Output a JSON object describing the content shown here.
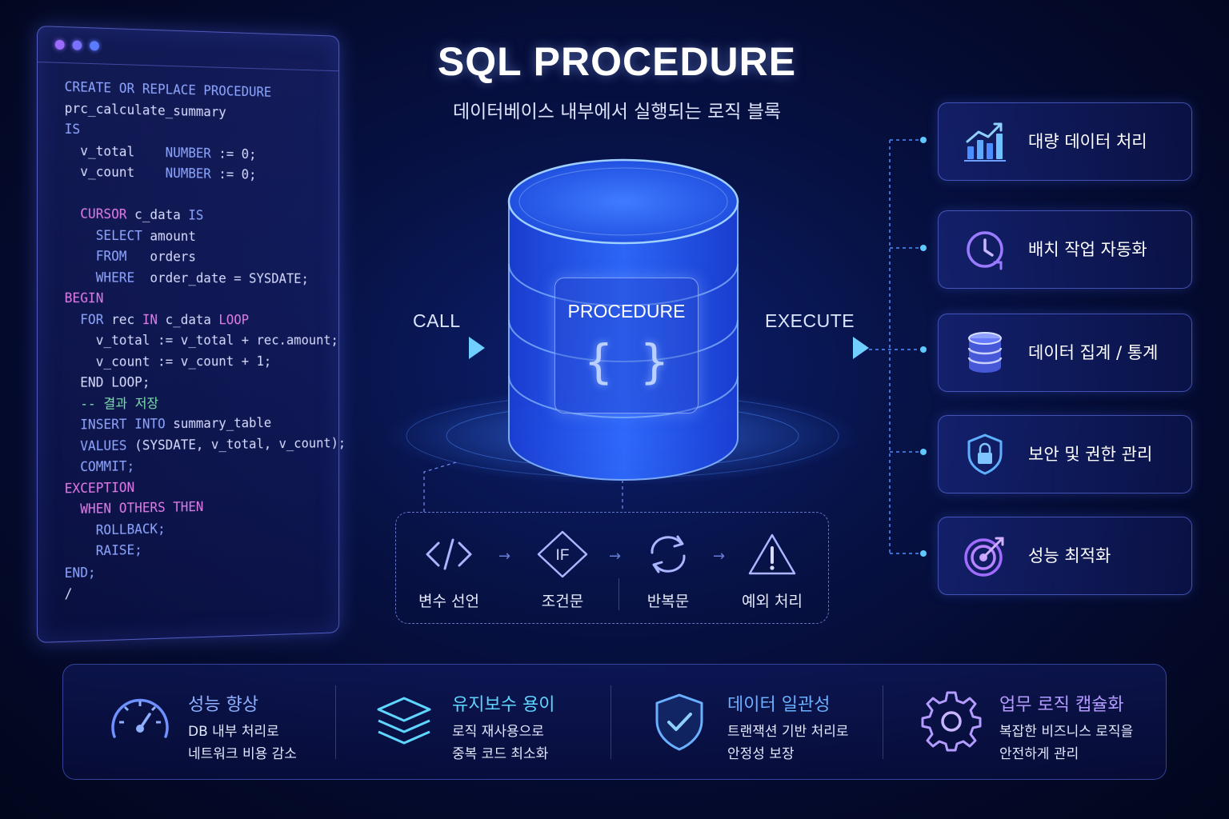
{
  "header": {
    "title": "SQL PROCEDURE",
    "subtitle": "데이터베이스 내부에서 실행되는 로직 블록"
  },
  "colors": {
    "accent": "#3d7bff",
    "title_dot_1": "#9b6bff",
    "title_dot_2": "#7a72ff",
    "title_dot_3": "#5b7bff",
    "keyword_blue": "#8ea6ff",
    "keyword_pink": "#e07ce8",
    "comment_green": "#7fe0b0"
  },
  "code": {
    "lines": [
      [
        {
          "t": "CREATE OR REPLACE PROCEDURE",
          "c": "kw"
        }
      ],
      [
        {
          "t": "prc_calculate_summary",
          "c": "id"
        }
      ],
      [
        {
          "t": "IS",
          "c": "kw"
        }
      ],
      [
        {
          "t": "  v_total    ",
          "c": "id"
        },
        {
          "t": "NUMBER",
          "c": "kw"
        },
        {
          "t": " := 0;",
          "c": "id"
        }
      ],
      [
        {
          "t": "  v_count    ",
          "c": "id"
        },
        {
          "t": "NUMBER",
          "c": "kw"
        },
        {
          "t": " := 0;",
          "c": "id"
        }
      ],
      [
        {
          "t": "",
          "c": "id"
        }
      ],
      [
        {
          "t": "  CURSOR",
          "c": "kw2"
        },
        {
          "t": " c_data ",
          "c": "id"
        },
        {
          "t": "IS",
          "c": "kw"
        }
      ],
      [
        {
          "t": "    SELECT",
          "c": "kw"
        },
        {
          "t": " amount",
          "c": "id"
        }
      ],
      [
        {
          "t": "    FROM",
          "c": "kw"
        },
        {
          "t": "   orders",
          "c": "id"
        }
      ],
      [
        {
          "t": "    WHERE",
          "c": "kw"
        },
        {
          "t": "  order_date = SYSDATE;",
          "c": "id"
        }
      ],
      [
        {
          "t": "BEGIN",
          "c": "kw2"
        }
      ],
      [
        {
          "t": "  FOR",
          "c": "kw"
        },
        {
          "t": " rec ",
          "c": "id"
        },
        {
          "t": "IN",
          "c": "kw2"
        },
        {
          "t": " c_data ",
          "c": "id"
        },
        {
          "t": "LOOP",
          "c": "kw2"
        }
      ],
      [
        {
          "t": "    v_total := v_total + rec.amount;",
          "c": "id"
        }
      ],
      [
        {
          "t": "    v_count := v_count + 1;",
          "c": "id"
        }
      ],
      [
        {
          "t": "  END LOOP;",
          "c": "id"
        }
      ],
      [
        {
          "t": "  -- 결과 저장",
          "c": "cm"
        }
      ],
      [
        {
          "t": "  INSERT INTO",
          "c": "kw"
        },
        {
          "t": " summary_table",
          "c": "id"
        }
      ],
      [
        {
          "t": "  VALUES",
          "c": "kw"
        },
        {
          "t": " (SYSDATE, v_total, v_count);",
          "c": "id"
        }
      ],
      [
        {
          "t": "  COMMIT;",
          "c": "kw"
        }
      ],
      [
        {
          "t": "EXCEPTION",
          "c": "kw2"
        }
      ],
      [
        {
          "t": "  WHEN OTHERS THEN",
          "c": "kw2"
        }
      ],
      [
        {
          "t": "    ROLLBACK;",
          "c": "kw"
        }
      ],
      [
        {
          "t": "    RAISE;",
          "c": "kw"
        }
      ],
      [
        {
          "t": "END;",
          "c": "kw"
        }
      ],
      [
        {
          "t": "/",
          "c": "id"
        }
      ]
    ]
  },
  "flow": {
    "call_label": "CALL",
    "execute_label": "EXECUTE",
    "procedure_label": "PROCEDURE",
    "procedure_icon": "{ }"
  },
  "steps": [
    {
      "label": "변수 선언",
      "icon": "code-icon"
    },
    {
      "label": "조건문",
      "icon": "if-diamond-icon",
      "icon_text": "IF"
    },
    {
      "label": "반복문",
      "icon": "loop-icon"
    },
    {
      "label": "예외 처리",
      "icon": "warning-icon"
    }
  ],
  "features": [
    {
      "label": "대량 데이터 처리",
      "icon": "bar-chart-icon"
    },
    {
      "label": "배치 작업 자동화",
      "icon": "clock-icon"
    },
    {
      "label": "데이터 집계 / 통계",
      "icon": "database-icon"
    },
    {
      "label": "보안 및 권한 관리",
      "icon": "lock-shield-icon"
    },
    {
      "label": "성능 최적화",
      "icon": "target-icon"
    }
  ],
  "benefits": [
    {
      "title": "성능 향상",
      "desc": [
        "DB 내부 처리로",
        "네트워크 비용 감소"
      ],
      "icon": "speedometer-icon",
      "color": "#8fb0ff"
    },
    {
      "title": "유지보수 용이",
      "desc": [
        "로직 재사용으로",
        "중복 코드 최소화"
      ],
      "icon": "layers-icon",
      "color": "#5fd6ff"
    },
    {
      "title": "데이터 일관성",
      "desc": [
        "트랜잭션 기반 처리로",
        "안정성 보장"
      ],
      "icon": "shield-check-icon",
      "color": "#6ab0ff"
    },
    {
      "title": "업무 로직 캡슐화",
      "desc": [
        "복잡한 비즈니스 로직을",
        "안전하게 관리"
      ],
      "icon": "gear-icon",
      "color": "#b49bff"
    }
  ]
}
